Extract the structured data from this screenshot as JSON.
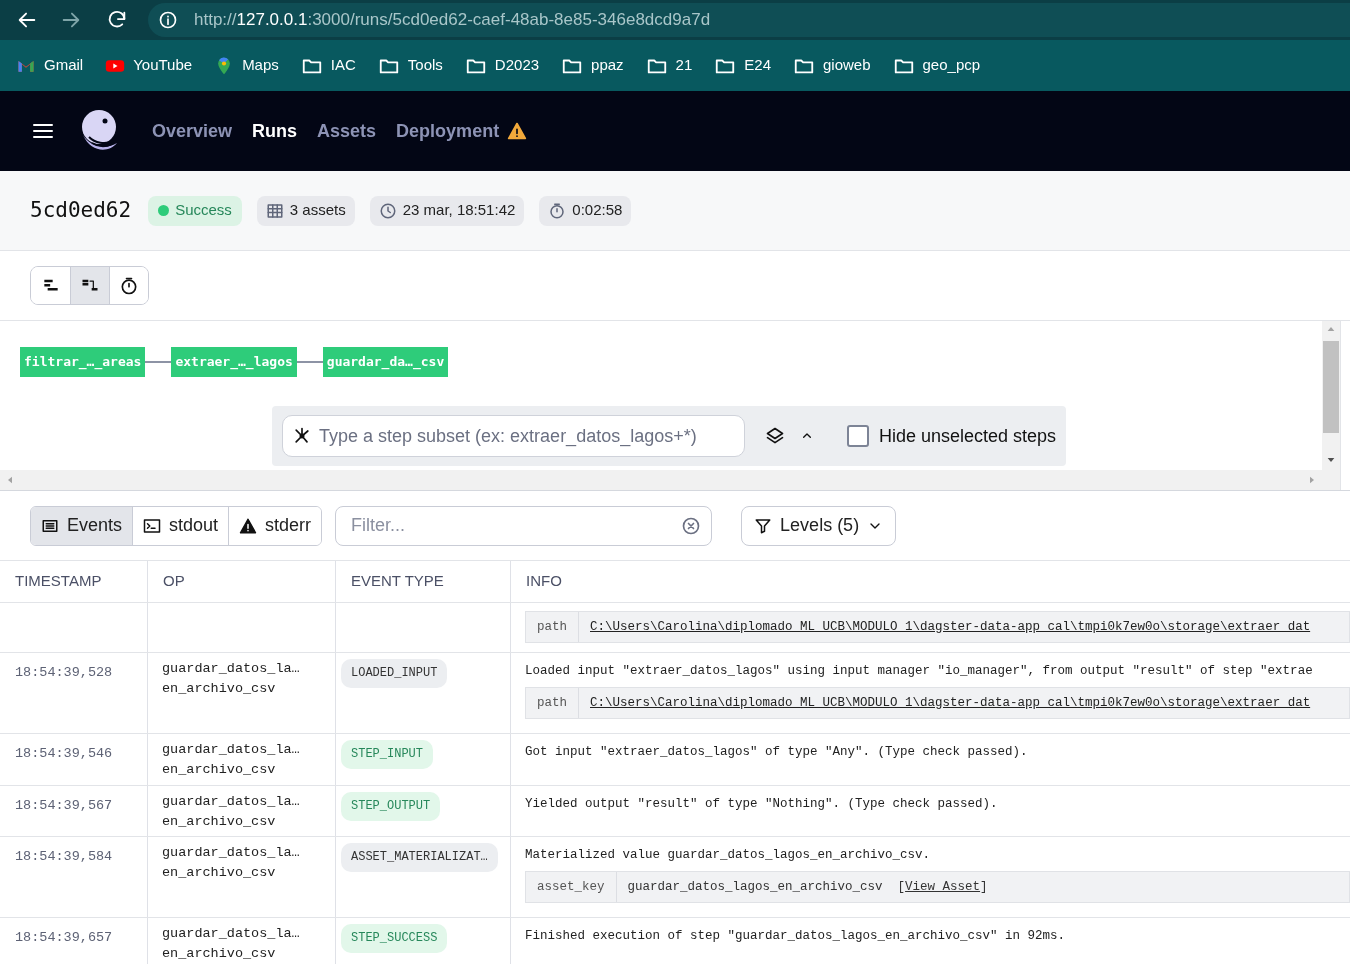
{
  "browser": {
    "url_scheme": "http://",
    "url_host": "127.0.0.1",
    "url_rest": ":3000/runs/5cd0ed62-caef-48ab-8e85-346e8dcd9a7d"
  },
  "bookmarks": [
    {
      "kind": "gmail",
      "label": "Gmail"
    },
    {
      "kind": "youtube",
      "label": "YouTube"
    },
    {
      "kind": "maps",
      "label": "Maps"
    },
    {
      "kind": "folder",
      "label": "IAC"
    },
    {
      "kind": "folder",
      "label": "Tools"
    },
    {
      "kind": "folder",
      "label": "D2023"
    },
    {
      "kind": "folder",
      "label": "ppaz"
    },
    {
      "kind": "folder",
      "label": "21"
    },
    {
      "kind": "folder",
      "label": "E24"
    },
    {
      "kind": "folder",
      "label": "gioweb"
    },
    {
      "kind": "folder",
      "label": "geo_pcp"
    }
  ],
  "nav": [
    {
      "label": "Overview",
      "selected": false,
      "warning": false
    },
    {
      "label": "Runs",
      "selected": true,
      "warning": false
    },
    {
      "label": "Assets",
      "selected": false,
      "warning": false
    },
    {
      "label": "Deployment",
      "selected": false,
      "warning": true
    }
  ],
  "run": {
    "id": "5cd0ed62",
    "status": "Success",
    "assets": "3 assets",
    "started": "23 mar, 18:51:42",
    "duration": "0:02:58"
  },
  "view_buttons": [
    {
      "kind": "list",
      "selected": false
    },
    {
      "kind": "tree",
      "selected": true
    },
    {
      "kind": "timer",
      "selected": false
    }
  ],
  "graph": {
    "nodes": [
      "filtrar_…_areas",
      "extraer_…_lagos",
      "guardar_da…_csv"
    ],
    "step_subset_placeholder": "Type a step subset (ex: extraer_datos_lagos+*)",
    "hide_unselected": {
      "label": "Hide unselected steps",
      "checked": false
    }
  },
  "log_tabs": [
    {
      "kind": "events",
      "label": "Events",
      "selected": true
    },
    {
      "kind": "stdout",
      "label": "stdout",
      "selected": false
    },
    {
      "kind": "stderr",
      "label": "stderr",
      "selected": false
    }
  ],
  "filter_placeholder": "Filter...",
  "levels": "Levels (5)",
  "table": {
    "columns": [
      "TIMESTAMP",
      "OP",
      "EVENT TYPE",
      "INFO"
    ],
    "rows": [
      {
        "meta": {
          "key": "path",
          "value": "C:\\Users\\Carolina\\diplomado_ML_UCB\\MODULO_1\\dagster-data-app_cal\\tmpi0k7ew0o\\storage\\extraer_dat",
          "kind": "link"
        }
      },
      {
        "timestamp": "18:54:39,528",
        "op": [
          "guardar_datos_la…",
          "en_archivo_csv"
        ],
        "event": {
          "label": "LOADED_INPUT",
          "kind": "neutral"
        },
        "message": "Loaded input \"extraer_datos_lagos\" using input manager \"io_manager\", from output \"result\" of step \"extrae",
        "meta": {
          "key": "path",
          "value": "C:\\Users\\Carolina\\diplomado_ML_UCB\\MODULO_1\\dagster-data-app_cal\\tmpi0k7ew0o\\storage\\extraer_dat",
          "kind": "link"
        }
      },
      {
        "timestamp": "18:54:39,546",
        "op": [
          "guardar_datos_la…",
          "en_archivo_csv"
        ],
        "event": {
          "label": "STEP_INPUT",
          "kind": "success"
        },
        "message": "Got input \"extraer_datos_lagos\" of type \"Any\". (Type check passed)."
      },
      {
        "timestamp": "18:54:39,567",
        "op": [
          "guardar_datos_la…",
          "en_archivo_csv"
        ],
        "event": {
          "label": "STEP_OUTPUT",
          "kind": "success"
        },
        "message": "Yielded output \"result\" of type \"Nothing\". (Type check passed)."
      },
      {
        "timestamp": "18:54:39,584",
        "op": [
          "guardar_datos_la…",
          "en_archivo_csv"
        ],
        "event": {
          "label": "ASSET_MATERIALIZAT…",
          "kind": "neutral"
        },
        "message": "Materialized value guardar_datos_lagos_en_archivo_csv.",
        "meta": {
          "key": "asset_key",
          "value": "guardar_datos_lagos_en_archivo_csv",
          "kind": "asset",
          "link": "View Asset",
          "open": "[",
          "close": "]"
        }
      },
      {
        "timestamp": "18:54:39,657",
        "op": [
          "guardar_datos_la…",
          "en_archivo_csv"
        ],
        "event": {
          "label": "STEP_SUCCESS",
          "kind": "success"
        },
        "message": "Finished execution of step \"guardar_datos_lagos_en_archivo_csv\" in 92ms."
      }
    ]
  }
}
